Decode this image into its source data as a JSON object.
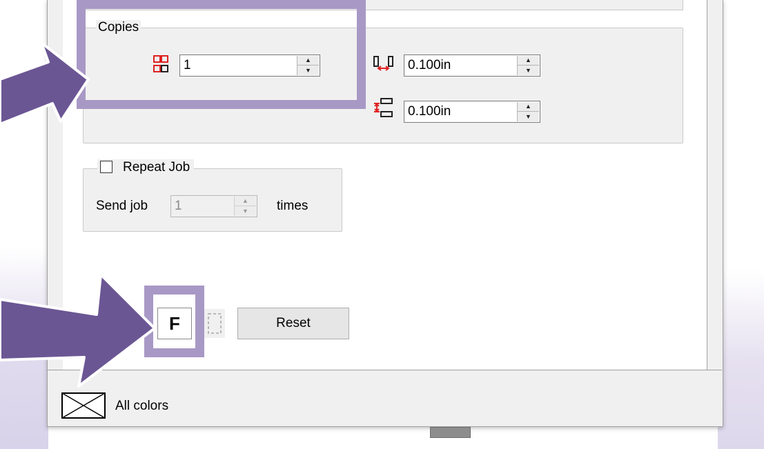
{
  "copies": {
    "legend": "Copies",
    "count_value": "1",
    "horizontal_spacing_value": "0.100in",
    "vertical_spacing_value": "0.100in"
  },
  "repeat_job": {
    "checkbox_label": "Repeat Job",
    "checked": false,
    "send_label": "Send job",
    "times_value": "1",
    "times_label": "times"
  },
  "toolbar": {
    "f_button_label": "F",
    "reset_label": "Reset"
  },
  "status": {
    "colors_label": "All colors"
  },
  "icons": {
    "copies_grid": "copies-grid-icon",
    "horizontal_spacing": "horizontal-spacing-icon",
    "vertical_spacing": "vertical-spacing-icon",
    "frame": "frame-icon",
    "color_swatch": "no-color-swatch-icon"
  },
  "colors": {
    "highlight": "#a898c5",
    "arrow": "#6b5694",
    "icon_red": "#e02020"
  }
}
